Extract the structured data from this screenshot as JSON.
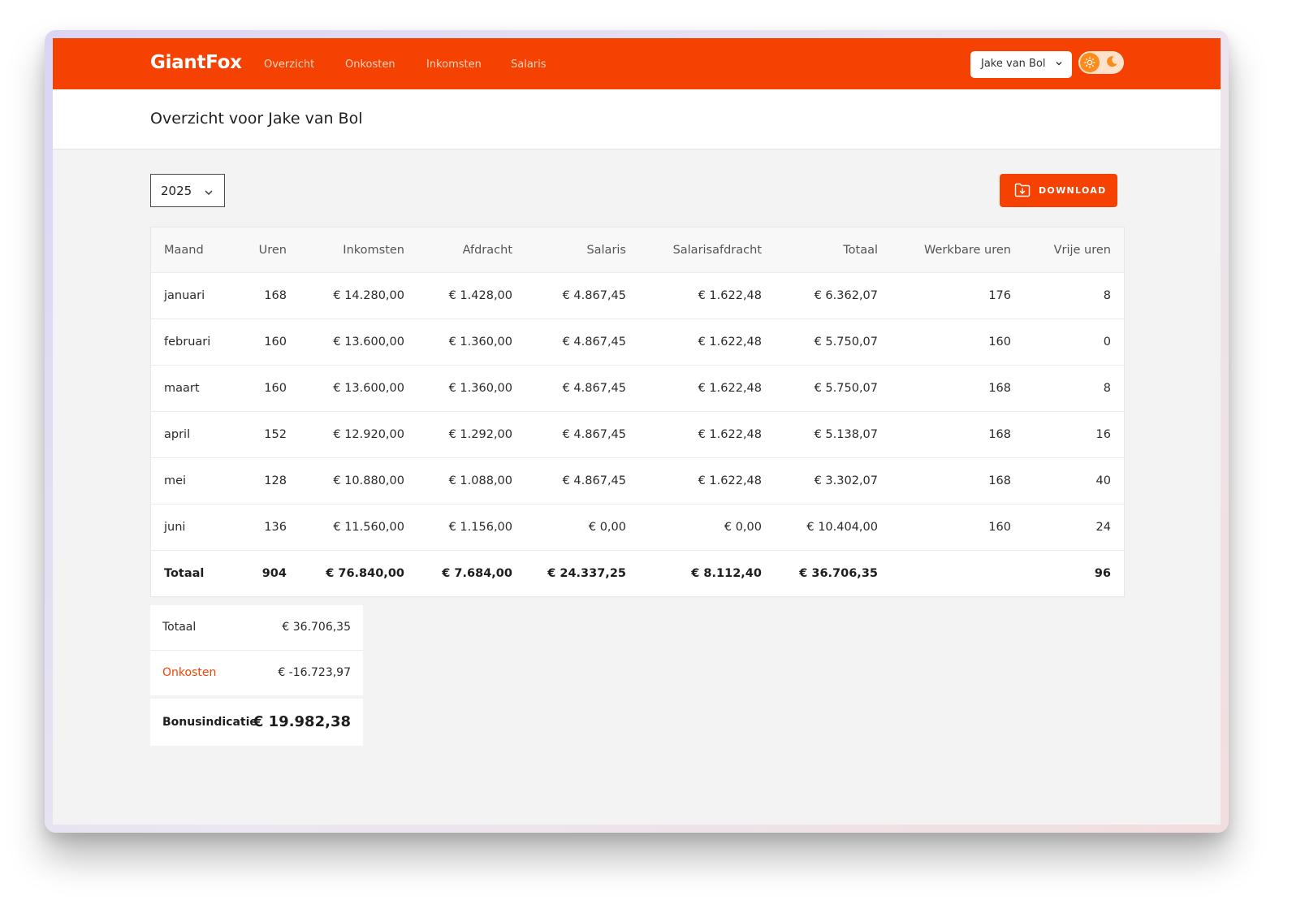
{
  "nav": {
    "brand": "GiantFox",
    "links": [
      "Overzicht",
      "Onkosten",
      "Inkomsten",
      "Salaris"
    ],
    "user_select": "Jake van Bol"
  },
  "header": {
    "title": "Overzicht voor Jake van Bol"
  },
  "toolbar": {
    "year": "2025",
    "download_label": "DOWNLOAD"
  },
  "table": {
    "columns": [
      "Maand",
      "Uren",
      "Inkomsten",
      "Afdracht",
      "Salaris",
      "Salarisafdracht",
      "Totaal",
      "Werkbare uren",
      "Vrije uren"
    ],
    "rows": [
      [
        "januari",
        "168",
        "€ 14.280,00",
        "€ 1.428,00",
        "€ 4.867,45",
        "€ 1.622,48",
        "€ 6.362,07",
        "176",
        "8"
      ],
      [
        "februari",
        "160",
        "€ 13.600,00",
        "€ 1.360,00",
        "€ 4.867,45",
        "€ 1.622,48",
        "€ 5.750,07",
        "160",
        "0"
      ],
      [
        "maart",
        "160",
        "€ 13.600,00",
        "€ 1.360,00",
        "€ 4.867,45",
        "€ 1.622,48",
        "€ 5.750,07",
        "168",
        "8"
      ],
      [
        "april",
        "152",
        "€ 12.920,00",
        "€ 1.292,00",
        "€ 4.867,45",
        "€ 1.622,48",
        "€ 5.138,07",
        "168",
        "16"
      ],
      [
        "mei",
        "128",
        "€ 10.880,00",
        "€ 1.088,00",
        "€ 4.867,45",
        "€ 1.622,48",
        "€ 3.302,07",
        "168",
        "40"
      ],
      [
        "juni",
        "136",
        "€ 11.560,00",
        "€ 1.156,00",
        "€ 0,00",
        "€ 0,00",
        "€ 10.404,00",
        "160",
        "24"
      ]
    ],
    "total": [
      "Totaal",
      "904",
      "€ 76.840,00",
      "€ 7.684,00",
      "€ 24.337,25",
      "€ 8.112,40",
      "€ 36.706,35",
      "",
      "96"
    ]
  },
  "summary": {
    "total_label": "Totaal",
    "total_value": "€ 36.706,35",
    "costs_label": "Onkosten",
    "costs_value": "€ -16.723,97",
    "bonus_label": "Bonusindicatie",
    "bonus_value": "€ 19.982,38"
  },
  "colors": {
    "accent": "#f54203",
    "background": "#f3f3f3"
  },
  "icons": {
    "user_chevron": "chevron-down-icon",
    "theme_light": "sun-icon",
    "theme_dark": "moon-icon",
    "download": "folder-download-icon"
  }
}
